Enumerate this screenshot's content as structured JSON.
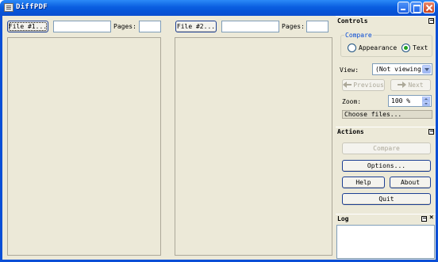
{
  "window": {
    "title": "DiffPDF"
  },
  "left": {
    "file_button": "File #1...",
    "file_value": "",
    "pages_label": "Pages:",
    "pages_value": ""
  },
  "right": {
    "file_button": "File #2...",
    "file_value": "",
    "pages_label": "Pages:",
    "pages_value": ""
  },
  "controls": {
    "title": "Controls",
    "compare_group": "Compare",
    "appearance_label": "Appearance",
    "text_label": "Text",
    "selected": "Text",
    "view_label": "View:",
    "view_value": "(Not viewing)",
    "previous_label": "Previous",
    "next_label": "Next",
    "zoom_label": "Zoom:",
    "zoom_value": "100 %",
    "choose_files": "Choose files..."
  },
  "actions": {
    "title": "Actions",
    "compare": "Compare",
    "options": "Options...",
    "help": "Help",
    "about": "About",
    "quit": "Quit"
  },
  "log": {
    "title": "Log"
  }
}
